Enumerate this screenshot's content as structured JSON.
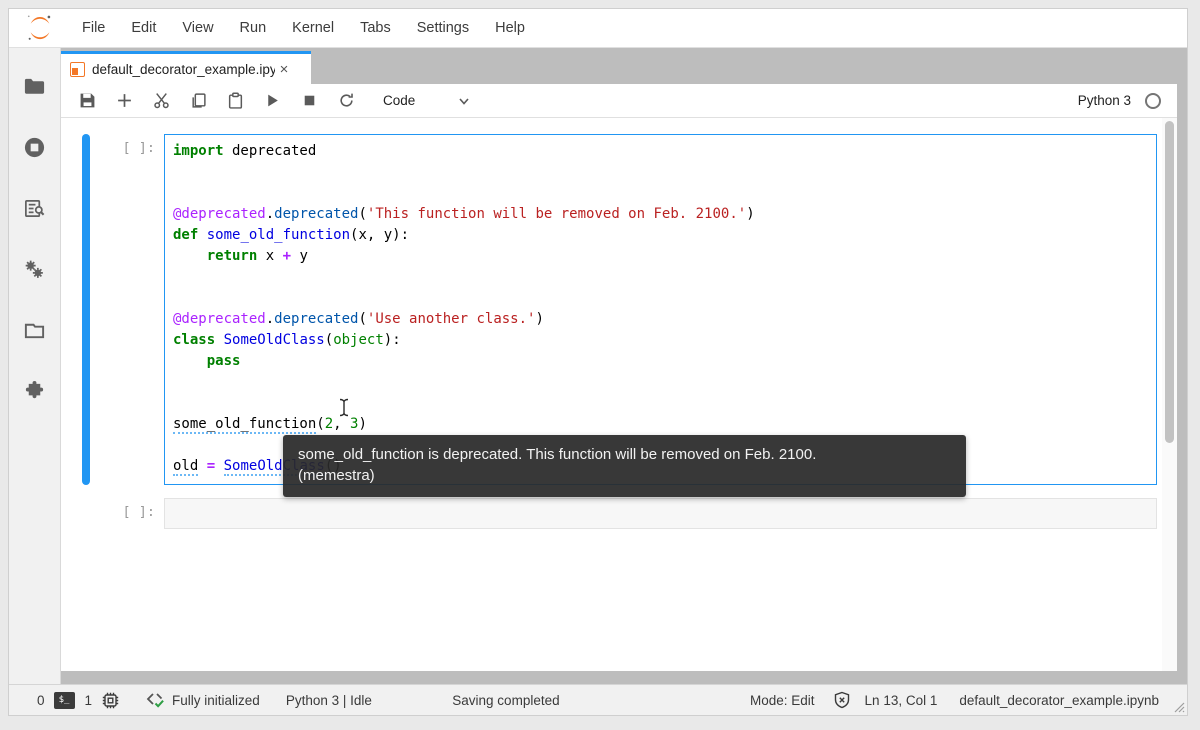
{
  "menu": {
    "items": [
      "File",
      "Edit",
      "View",
      "Run",
      "Kernel",
      "Tabs",
      "Settings",
      "Help"
    ]
  },
  "tab": {
    "title": "default_decorator_example.ipynb",
    "close_label": "×"
  },
  "toolbar": {
    "cell_type": "Code",
    "kernel_name": "Python 3",
    "icons": [
      "save-icon",
      "add-cell-icon",
      "cut-icon",
      "copy-icon",
      "paste-icon",
      "run-icon",
      "stop-icon",
      "restart-kernel-icon",
      "kernel-status-idle-icon"
    ]
  },
  "sidebar": {
    "icons": [
      "file-browser-icon",
      "running-kernels-icon",
      "command-palette-icon",
      "property-inspector-icon",
      "open-tabs-icon",
      "extension-manager-icon"
    ]
  },
  "cells": [
    {
      "prompt": "[ ]:",
      "lines": [
        [
          {
            "t": "import",
            "c": "kw"
          },
          {
            "t": " deprecated",
            "c": "pl"
          }
        ],
        [],
        [],
        [
          {
            "t": "@deprecated",
            "c": "dec"
          },
          {
            "t": ".",
            "c": "pl"
          },
          {
            "t": "deprecated",
            "c": "prop"
          },
          {
            "t": "(",
            "c": "pl"
          },
          {
            "t": "'This function will be removed on Feb. 2100.'",
            "c": "str"
          },
          {
            "t": ")",
            "c": "pl"
          }
        ],
        [
          {
            "t": "def",
            "c": "kw"
          },
          {
            "t": " ",
            "c": "pl"
          },
          {
            "t": "some_old_function",
            "c": "fn"
          },
          {
            "t": "(x, y):",
            "c": "pl"
          }
        ],
        [
          {
            "t": "    ",
            "c": "pl"
          },
          {
            "t": "return",
            "c": "kw"
          },
          {
            "t": " x ",
            "c": "pl"
          },
          {
            "t": "+",
            "c": "op"
          },
          {
            "t": " y",
            "c": "pl"
          }
        ],
        [],
        [],
        [
          {
            "t": "@deprecated",
            "c": "dec"
          },
          {
            "t": ".",
            "c": "pl"
          },
          {
            "t": "deprecated",
            "c": "prop"
          },
          {
            "t": "(",
            "c": "pl"
          },
          {
            "t": "'Use another class.'",
            "c": "str"
          },
          {
            "t": ")",
            "c": "pl"
          }
        ],
        [
          {
            "t": "class",
            "c": "kw"
          },
          {
            "t": " ",
            "c": "pl"
          },
          {
            "t": "SomeOldClass",
            "c": "fn"
          },
          {
            "t": "(",
            "c": "pl"
          },
          {
            "t": "object",
            "c": "blt"
          },
          {
            "t": "):",
            "c": "pl"
          }
        ],
        [
          {
            "t": "    ",
            "c": "pl"
          },
          {
            "t": "pass",
            "c": "kw"
          }
        ],
        [],
        [],
        [
          {
            "t": "some_old_function",
            "c": "pl diag"
          },
          {
            "t": "(",
            "c": "pl"
          },
          {
            "t": "2",
            "c": "num"
          },
          {
            "t": ", ",
            "c": "pl"
          },
          {
            "t": "3",
            "c": "num"
          },
          {
            "t": ")",
            "c": "pl"
          }
        ],
        [],
        [
          {
            "t": "old",
            "c": "pl diag"
          },
          {
            "t": " ",
            "c": "pl"
          },
          {
            "t": "=",
            "c": "op"
          },
          {
            "t": " ",
            "c": "pl"
          },
          {
            "t": "SomeOldClass",
            "c": "fn diag"
          },
          {
            "t": "()",
            "c": "pl"
          }
        ]
      ]
    },
    {
      "prompt": "[ ]:"
    }
  ],
  "tooltip": {
    "line1": "some_old_function is deprecated. This function will be removed on Feb. 2100.",
    "line2": "(memestra)"
  },
  "statusbar": {
    "terminals_count": "0",
    "kernels_count": "1",
    "lsp_status": "Fully initialized",
    "kernel_status": "Python 3 | Idle",
    "saving_status": "Saving completed",
    "mode": "Mode: Edit",
    "cursor_position": "Ln 13, Col 1",
    "filename": "default_decorator_example.ipynb"
  },
  "colors": {
    "accent": "#2196f3",
    "brand_orange": "#f37726",
    "lsp_green": "#2e9e44",
    "tooltip_bg": "#292929"
  }
}
